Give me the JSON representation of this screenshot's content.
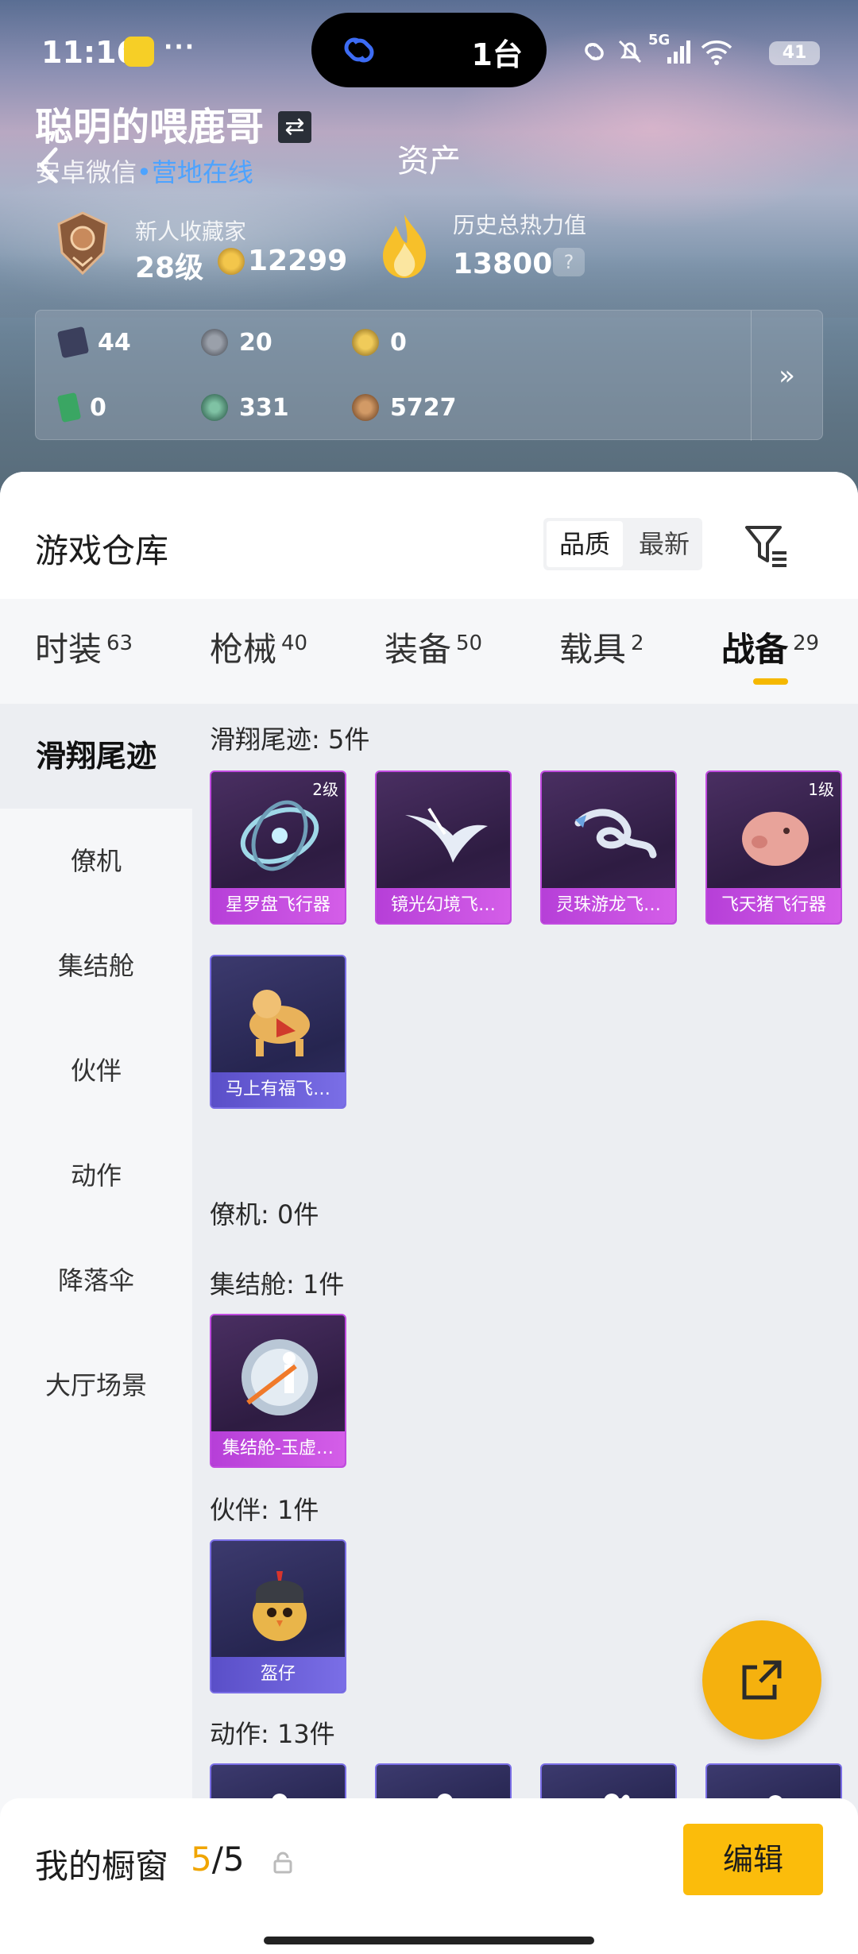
{
  "status": {
    "time": "11:16",
    "dots": "···",
    "island_count": "1台",
    "battery": "41",
    "network": "5G"
  },
  "header": {
    "title": "资产"
  },
  "profile": {
    "nickname": "聪明的喂鹿哥",
    "platform": "安卓微信",
    "online_dot": "•",
    "online_status": "营地在线",
    "rank_title": "新人收藏家",
    "level": "28级",
    "coins": "12299",
    "heat_title": "历史总热力值",
    "heat_value": "13800",
    "help": "?"
  },
  "resources": {
    "items": [
      {
        "icon": "card-icon",
        "value": "44",
        "color": "#3b3f5c"
      },
      {
        "icon": "silver-coin-icon",
        "value": "20",
        "color": "#4a4e58"
      },
      {
        "icon": "gold-badge-icon",
        "value": "0",
        "color": "#c89a2e"
      },
      {
        "icon": "green-card-icon",
        "value": "0",
        "color": "#3aa663"
      },
      {
        "icon": "green-orb-icon",
        "value": "331",
        "color": "#3d7a63"
      },
      {
        "icon": "bronze-coin-icon",
        "value": "5727",
        "color": "#9a6233"
      }
    ],
    "more": "»"
  },
  "warehouse": {
    "title": "游戏仓库",
    "sort": [
      "品质",
      "最新"
    ],
    "tabs": [
      {
        "label": "时装",
        "count": "63"
      },
      {
        "label": "枪械",
        "count": "40"
      },
      {
        "label": "装备",
        "count": "50"
      },
      {
        "label": "载具",
        "count": "2"
      },
      {
        "label": "战备",
        "count": "29"
      }
    ],
    "categories": [
      "滑翔尾迹",
      "僚机",
      "集结舱",
      "伙伴",
      "动作",
      "降落伞",
      "大厅场景"
    ],
    "sections": [
      {
        "title": "滑翔尾迹: 5件",
        "items": [
          {
            "name": "星罗盘飞行器",
            "level": "2级",
            "rarity": "purple"
          },
          {
            "name": "镜光幻境飞…",
            "level": "",
            "rarity": "purple"
          },
          {
            "name": "灵珠游龙飞…",
            "level": "",
            "rarity": "purple"
          },
          {
            "name": "飞天猪飞行器",
            "level": "1级",
            "rarity": "purple"
          },
          {
            "name": "马上有福飞…",
            "level": "",
            "rarity": "blue"
          }
        ]
      },
      {
        "title": "僚机: 0件",
        "items": []
      },
      {
        "title": "集结舱: 1件",
        "items": [
          {
            "name": "集结舱-玉虚…",
            "level": "",
            "rarity": "purple"
          }
        ]
      },
      {
        "title": "伙伴: 1件",
        "items": [
          {
            "name": "盔仔",
            "level": "",
            "rarity": "blue"
          }
        ]
      },
      {
        "title": "动作: 13件",
        "items": []
      }
    ]
  },
  "showcase": {
    "label": "我的橱窗",
    "current": "5",
    "total": "5",
    "separator": "/",
    "edit": "编辑"
  }
}
